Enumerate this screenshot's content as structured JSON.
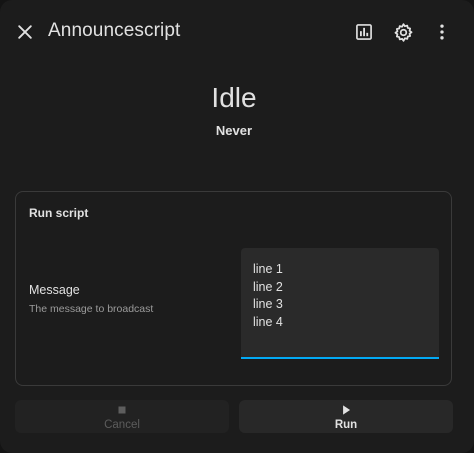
{
  "header": {
    "title": "Announcescript",
    "close_icon": "close-icon",
    "history_icon": "chart-box-icon",
    "settings_icon": "gear-icon",
    "menu_icon": "dots-vertical-icon"
  },
  "status": {
    "state": "Idle",
    "last_triggered": "Never"
  },
  "card": {
    "title": "Run script",
    "field": {
      "name": "Message",
      "description": "The message to broadcast",
      "value": "line 1\nline 2\nline 3\nline 4"
    }
  },
  "actions": {
    "cancel_label": "Cancel",
    "run_label": "Run",
    "cancel_icon": "stop-icon",
    "run_icon": "play-icon"
  },
  "colors": {
    "accent": "#03a9f4",
    "background": "#1c1c1c",
    "text": "#e1e1e1",
    "secondary_text": "#9b9b9b"
  }
}
